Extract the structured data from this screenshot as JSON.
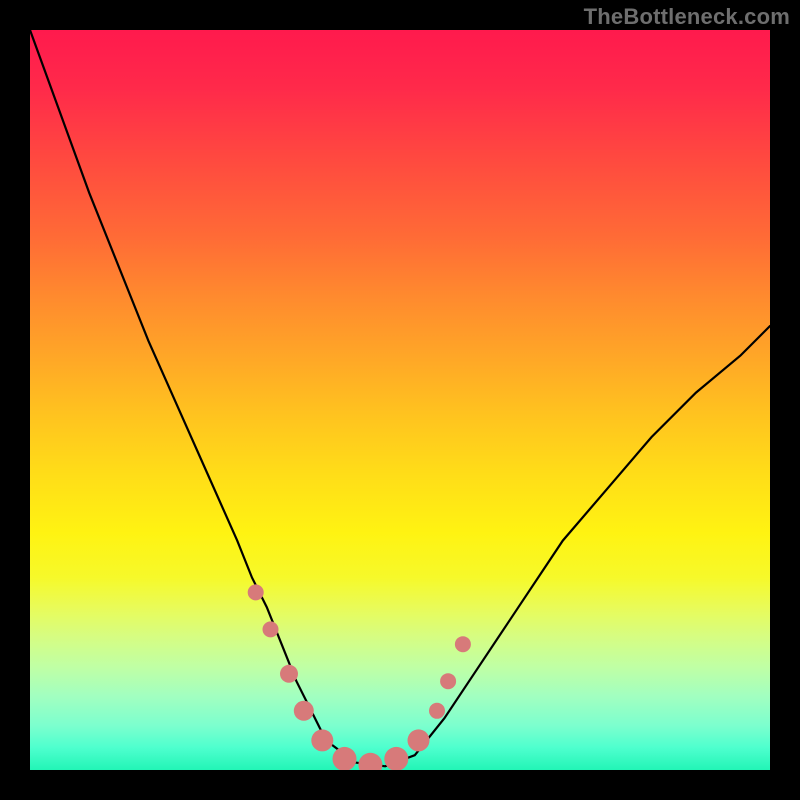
{
  "watermark": "TheBottleneck.com",
  "chart_data": {
    "type": "line",
    "title": "",
    "xlabel": "",
    "ylabel": "",
    "xlim": [
      0,
      100
    ],
    "ylim": [
      0,
      100
    ],
    "grid": false,
    "legend": false,
    "series": [
      {
        "name": "curve",
        "color": "#000000",
        "x": [
          0,
          4,
          8,
          12,
          16,
          20,
          24,
          28,
          30,
          32,
          34,
          36,
          38,
          40,
          44,
          48,
          52,
          56,
          60,
          66,
          72,
          78,
          84,
          90,
          96,
          100
        ],
        "y": [
          100,
          89,
          78,
          68,
          58,
          49,
          40,
          31,
          26,
          22,
          17,
          12,
          8,
          4,
          1,
          0.5,
          2,
          7,
          13,
          22,
          31,
          38,
          45,
          51,
          56,
          60
        ]
      }
    ],
    "markers": [
      {
        "x": 30.5,
        "y": 24,
        "r": 8,
        "color": "#d77a7a"
      },
      {
        "x": 32.5,
        "y": 19,
        "r": 8,
        "color": "#d77a7a"
      },
      {
        "x": 35,
        "y": 13,
        "r": 9,
        "color": "#d77a7a"
      },
      {
        "x": 37,
        "y": 8,
        "r": 10,
        "color": "#d77a7a"
      },
      {
        "x": 39.5,
        "y": 4,
        "r": 11,
        "color": "#d77a7a"
      },
      {
        "x": 42.5,
        "y": 1.5,
        "r": 12,
        "color": "#d77a7a"
      },
      {
        "x": 46,
        "y": 0.7,
        "r": 12,
        "color": "#d77a7a"
      },
      {
        "x": 49.5,
        "y": 1.5,
        "r": 12,
        "color": "#d77a7a"
      },
      {
        "x": 52.5,
        "y": 4,
        "r": 11,
        "color": "#d77a7a"
      },
      {
        "x": 55,
        "y": 8,
        "r": 8,
        "color": "#d77a7a"
      },
      {
        "x": 56.5,
        "y": 12,
        "r": 8,
        "color": "#d77a7a"
      },
      {
        "x": 58.5,
        "y": 17,
        "r": 8,
        "color": "#d77a7a"
      }
    ]
  }
}
